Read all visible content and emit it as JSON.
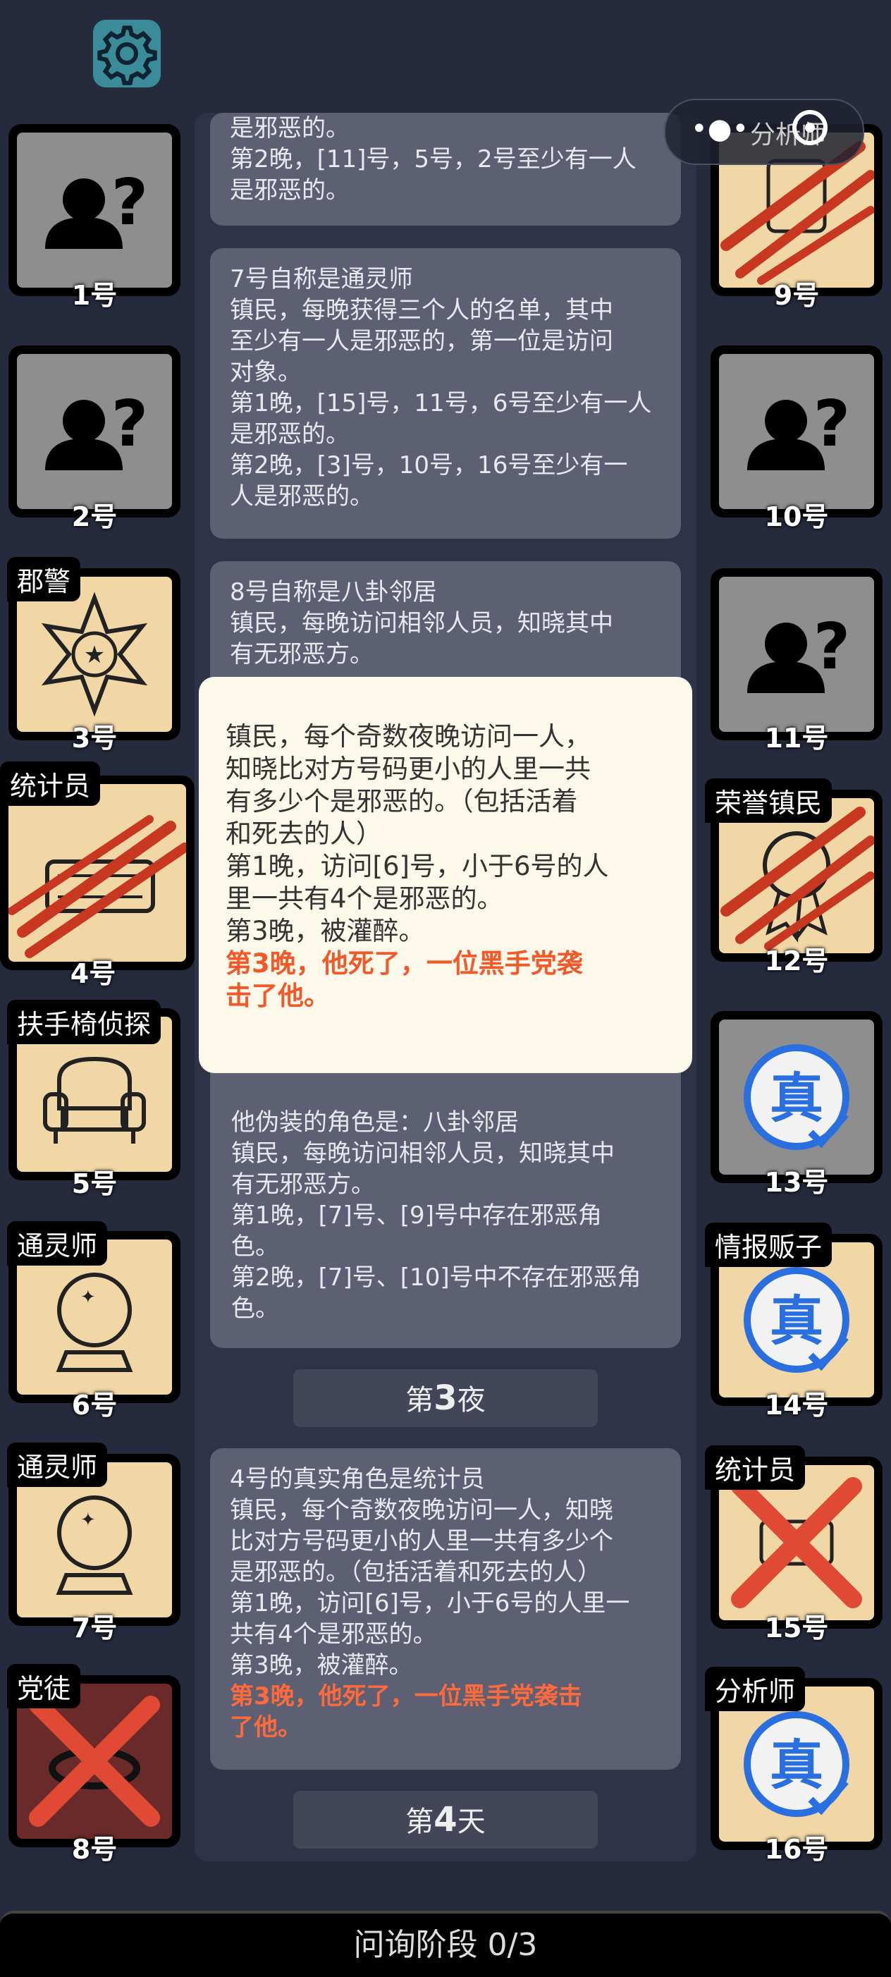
{
  "header": {
    "settings_icon": "gear-icon",
    "capsule_label": "分析师"
  },
  "left_players": [
    {
      "number": "1号",
      "role": "",
      "state": "unknown"
    },
    {
      "number": "2号",
      "role": "",
      "state": "unknown"
    },
    {
      "number": "3号",
      "role": "郡警",
      "state": "sheriff-badge"
    },
    {
      "number": "4号",
      "role": "统计员",
      "state": "abacus-clawed"
    },
    {
      "number": "5号",
      "role": "扶手椅侦探",
      "state": "armchair"
    },
    {
      "number": "6号",
      "role": "通灵师",
      "state": "crystal-ball"
    },
    {
      "number": "7号",
      "role": "通灵师",
      "state": "crystal-ball"
    },
    {
      "number": "8号",
      "role": "党徒",
      "state": "crossed-out"
    }
  ],
  "right_players": [
    {
      "number": "9号",
      "role": "",
      "state": "clawed"
    },
    {
      "number": "10号",
      "role": "",
      "state": "unknown"
    },
    {
      "number": "11号",
      "role": "",
      "state": "unknown"
    },
    {
      "number": "12号",
      "role": "荣誉镇民",
      "state": "medal-clawed"
    },
    {
      "number": "13号",
      "role": "",
      "state": "true-stamp"
    },
    {
      "number": "14号",
      "role": "情报贩子",
      "state": "true-stamp"
    },
    {
      "number": "15号",
      "role": "统计员",
      "state": "crossed-out"
    },
    {
      "number": "16号",
      "role": "分析师",
      "state": "true-stamp"
    }
  ],
  "log": {
    "card1": [
      "是邪恶的。",
      "第2晚，[11]号，5号，2号至少有一人",
      "是邪恶的。"
    ],
    "card2": [
      "7号自称是通灵师",
      "镇民，每晚获得三个人的名单，其中",
      "至少有一人是邪恶的，第一位是访问",
      "对象。",
      "第1晚，[15]号，11号，6号至少有一人",
      "是邪恶的。",
      "第2晚，[3]号，10号，16号至少有一",
      "人是邪恶的。"
    ],
    "card3": [
      "8号自称是八卦邻居",
      "镇民，每晚访问相邻人员，知晓其中",
      "有无邪恶方。"
    ],
    "card4": [
      "他伪装的角色是：八卦邻居",
      "镇民，每晚访问相邻人员，知晓其中",
      "有无邪恶方。",
      "第1晚，[7]号、[9]号中存在邪恶角",
      "色。",
      "第2晚，[7]号、[10]号中不存在邪恶角",
      "色。"
    ],
    "night3_label_prefix": "第",
    "night3_num": "3",
    "night3_label_suffix": "夜",
    "card5": [
      "4号的真实角色是统计员",
      "镇民，每个奇数夜晚访问一人，知晓",
      "比对方号码更小的人里一共有多少个",
      "是邪恶的。（包括活着和死去的人）",
      "第1晚，访问[6]号，小于6号的人里一",
      "共有4个是邪恶的。",
      "第3晚，被灌醉。"
    ],
    "card5_red": [
      "第3晚，他死了，一位黑手党袭击",
      "了他。"
    ],
    "day4_label_prefix": "第",
    "day4_num": "4",
    "day4_label_suffix": "天"
  },
  "tooltip": {
    "lines": [
      "镇民，每个奇数夜晚访问一人，",
      "知晓比对方号码更小的人里一共",
      "有多少个是邪恶的。（包括活着",
      "和死去的人）",
      "第1晚，访问[6]号，小于6号的人",
      "里一共有4个是邪恶的。",
      "第3晚，被灌醉。"
    ],
    "red_lines": [
      "第3晚，他死了，一位黑手党袭",
      "击了他。"
    ]
  },
  "bottom_bar": {
    "label": "问询阶段 0/3"
  },
  "colors": {
    "background": "#262a3d",
    "card": "#5c6072",
    "tile_cream": "#f2d7a6",
    "tile_unknown": "#8e8e8e",
    "claw_red": "#c8371f",
    "true_stamp": "#2a6fe0",
    "warning_red": "#ff6a3c"
  }
}
